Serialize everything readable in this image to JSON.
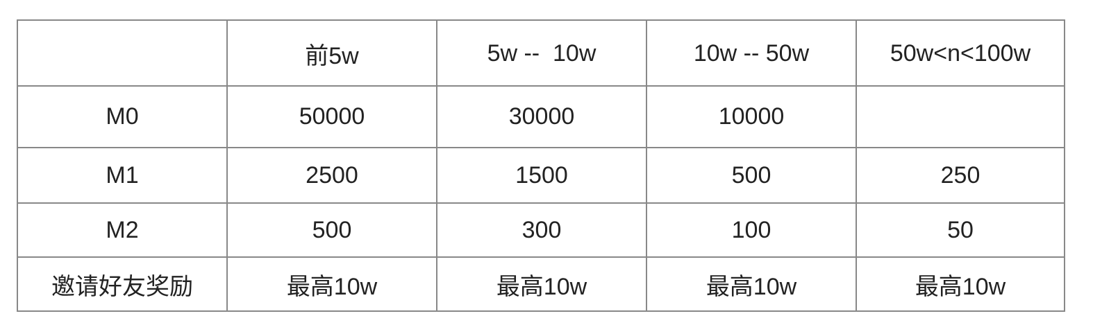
{
  "table": {
    "headers": [
      "",
      "前5w",
      "5w --  10w",
      "10w -- 50w",
      "50w<n<100w"
    ],
    "rows": [
      [
        "M0",
        "50000",
        "30000",
        "10000",
        ""
      ],
      [
        "M1",
        "2500",
        "1500",
        "500",
        "250"
      ],
      [
        "M2",
        "500",
        "300",
        "100",
        "50"
      ],
      [
        "邀请好友奖励",
        "最高10w",
        "最高10w",
        "最高10w",
        "最高10w"
      ]
    ]
  }
}
